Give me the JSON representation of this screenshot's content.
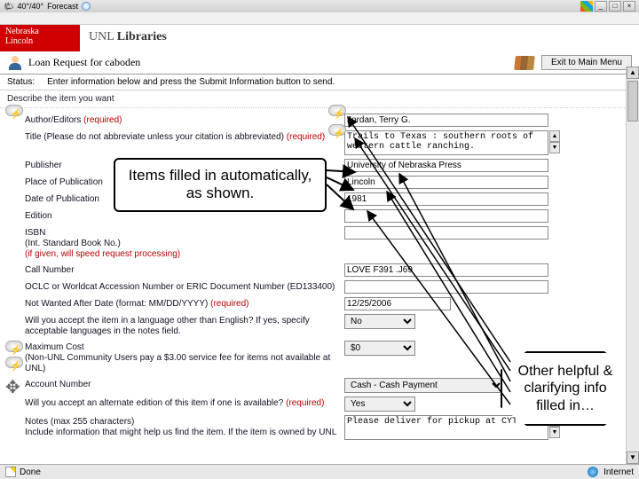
{
  "titlebar": {
    "temp": "40°/40°",
    "forecast_label": "Forecast"
  },
  "logo": {
    "line1": "Nebraska",
    "line2": "Lincoln"
  },
  "libs_prefix": "UNL",
  "libs_label": "Libraries",
  "loan_title": "Loan Request for caboden",
  "exit_label": "Exit to Main Menu",
  "status_label": "Status:",
  "status_text": "Enter information below and press the Submit Information button to send.",
  "describe": "Describe the item you want",
  "rows": {
    "author": {
      "label": "Author/Editors",
      "req": "(required)",
      "value": "Jordan, Terry G."
    },
    "title": {
      "label": "Title (Please do not abbreviate unless your citation is abbreviated)",
      "req": "(required)",
      "value": "Trails to Texas : southern roots of western cattle ranching."
    },
    "publisher": {
      "label": "Publisher",
      "value": "University of Nebraska Press"
    },
    "place": {
      "label": "Place of Publication",
      "value": "Lincoln"
    },
    "date": {
      "label": "Date of Publication",
      "value": "1981"
    },
    "edition": {
      "label": "Edition",
      "value": ""
    },
    "isbn": {
      "label": "ISBN",
      "sub": "(Int. Standard Book No.)",
      "hint": "(if given, will speed request processing)",
      "value": ""
    },
    "callno": {
      "label": "Call Number",
      "value": "LOVE F391 .J69"
    },
    "oclc": {
      "label": "OCLC or Worldcat Accession Number or ERIC Document Number (ED133400)",
      "value": ""
    },
    "notwanted": {
      "label": "Not Wanted After Date (format: MM/DD/YYYY)",
      "req": "(required)",
      "value": "12/25/2006"
    },
    "lang": {
      "label": "Will you accept the item in a language other than English? If yes, specify acceptable languages in the notes field.",
      "value": "No"
    },
    "maxcost": {
      "label": "Maximum Cost",
      "sub": "(Non-UNL Community Users pay a $3.00 service fee for items not available at UNL)",
      "value": "$0"
    },
    "acct": {
      "label": "Account Number",
      "value": "Cash - Cash Payment"
    },
    "altedition": {
      "label": "Will you accept an alternate edition of this item if one is available?",
      "req": "(required)",
      "value": "Yes"
    },
    "notes": {
      "label": "Notes (max 255 characters)",
      "sub": "Include information that might help us find the item. If the item is owned by UNL",
      "value": "Please deliver for pickup at CYT"
    }
  },
  "callout1": "Items filled in automatically, as shown.",
  "callout2": "Other helpful & clarifying info filled in…",
  "statusbar": {
    "done": "Done",
    "internet": "Internet"
  }
}
